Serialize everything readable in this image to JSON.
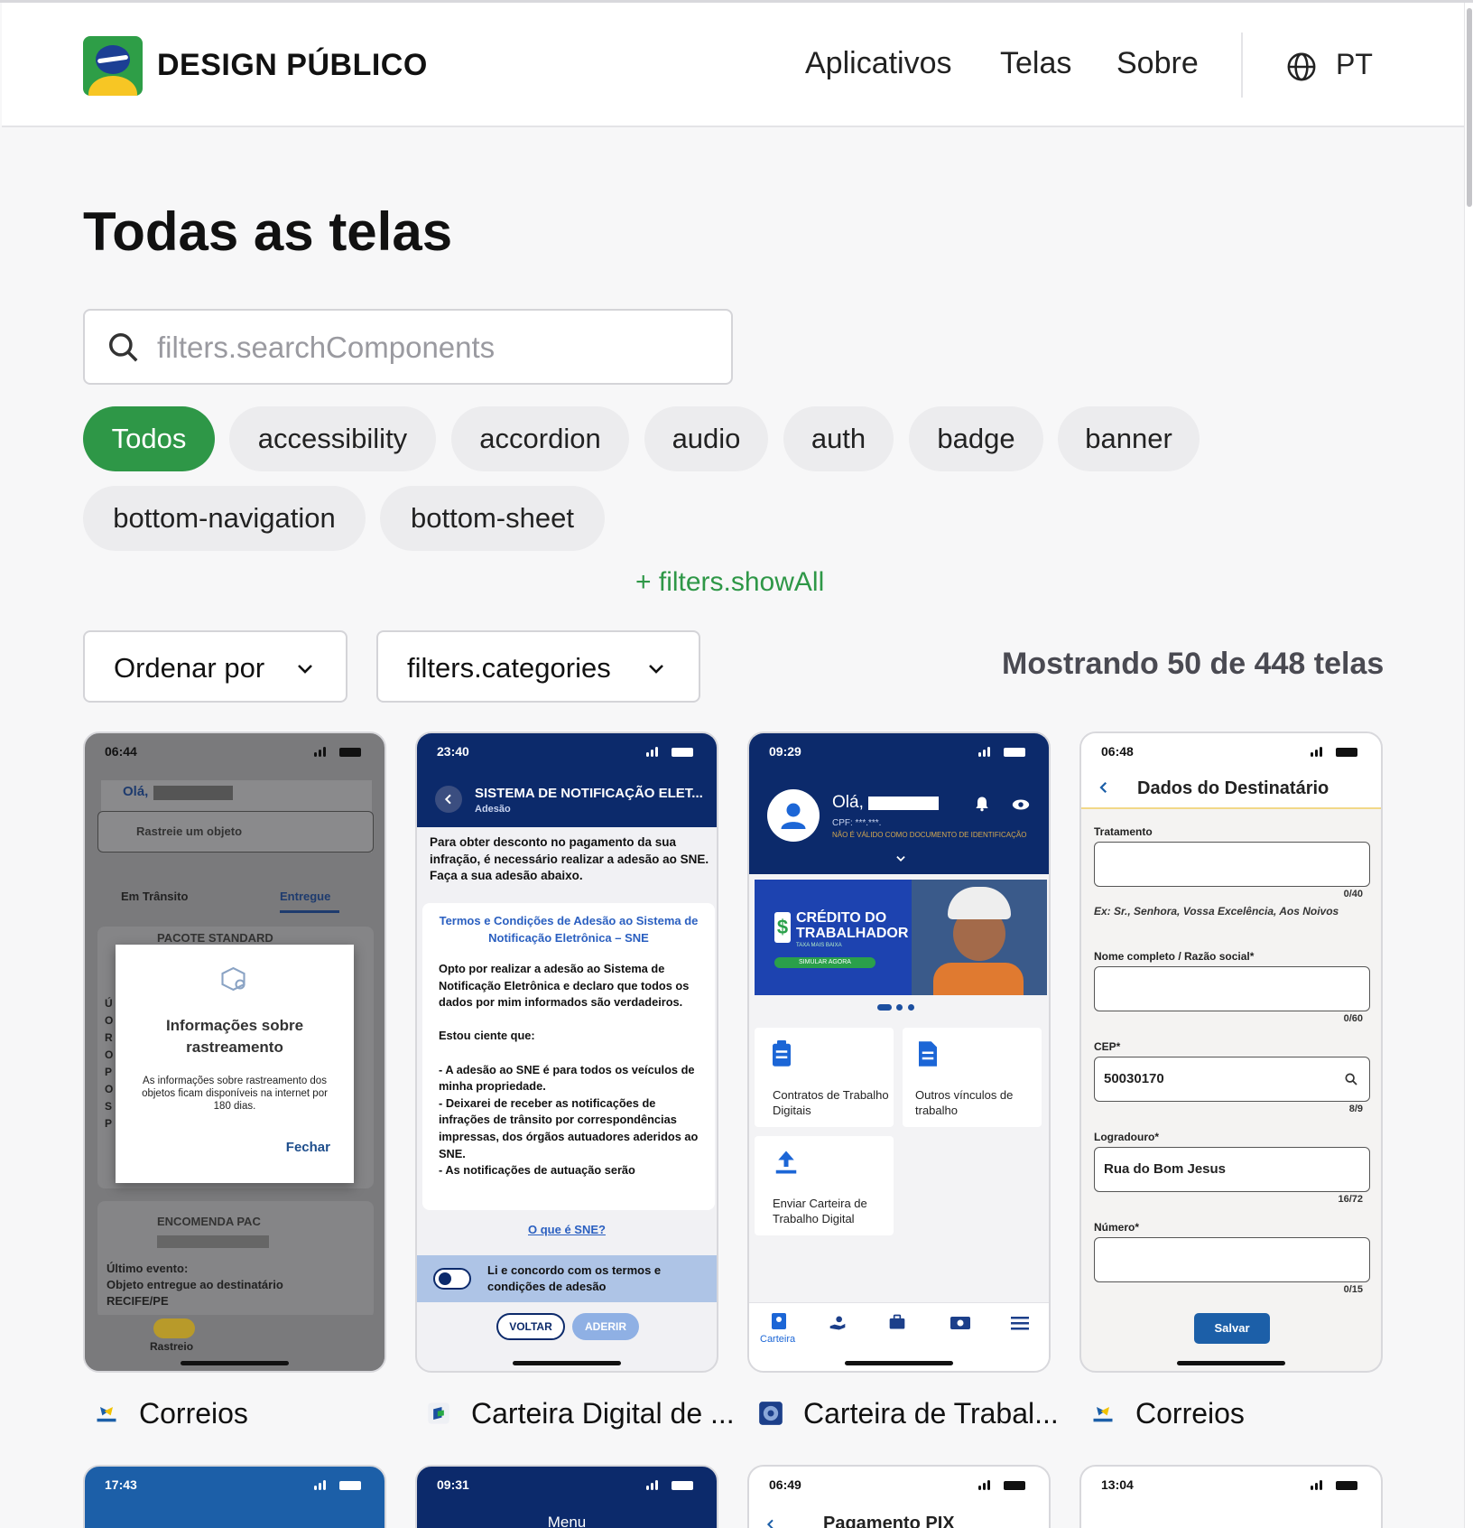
{
  "header": {
    "brand": "DESIGN PÚBLICO",
    "nav": [
      "Aplicativos",
      "Telas",
      "Sobre"
    ],
    "lang": "PT"
  },
  "page": {
    "title": "Todas as telas",
    "search_placeholder": "filters.searchComponents",
    "chips": [
      "Todos",
      "accessibility",
      "accordion",
      "audio",
      "auth",
      "badge",
      "banner",
      "bottom-navigation",
      "bottom-sheet"
    ],
    "show_all": "+ filters.showAll",
    "sort_label": "Ordenar por",
    "categories_label": "filters.categories",
    "count_text": "Mostrando 50 de 448 telas"
  },
  "colors": {
    "accent": "#2e9747",
    "navy": "#0c2a6b",
    "correios_blue": "#1c5fa8"
  },
  "cards": [
    {
      "app": "Correios",
      "time": "06:44",
      "greeting": "Olá,",
      "search": "Rastreie um objeto",
      "tab1": "Em Trânsito",
      "tab2": "Entregue",
      "under_title": "PACOTE STANDARD",
      "side_letters": [
        "Ú",
        "O",
        "R",
        "O",
        "P",
        "O",
        "S",
        "P"
      ],
      "modal_title": "Informações sobre rastreamento",
      "modal_text": "As informações sobre rastreamento dos objetos ficam disponíveis na internet por 180 dias.",
      "modal_btn": "Fechar",
      "item_title": "ENCOMENDA PAC",
      "last_event_label": "Último evento:",
      "last_event": "Objeto entregue ao destinatário",
      "city": "RECIFE/PE",
      "nav_label": "Rastreio"
    },
    {
      "app": "Carteira Digital de ...",
      "time": "23:40",
      "header_title": "SISTEMA DE NOTIFICAÇÃO ELET...",
      "header_sub": "Adesão",
      "intro": "Para obter desconto no pagamento da sua infração, é necessário realizar a adesão ao SNE.",
      "intro2": "Faça a sua adesão abaixo.",
      "terms_title": "Termos e Condições de Adesão ao Sistema de Notificação Eletrônica – SNE",
      "terms_p1": "Opto por realizar a adesão ao Sistema de Notificação Eletrônica e declaro que todos os dados por mim informados são verdadeiros.",
      "terms_p2": "Estou ciente que:",
      "terms_p3": "- A adesão ao SNE é para todos os veículos de minha propriedade.",
      "terms_p4": "- Deixarei de receber as notificações de infrações de trânsito por correspondências impressas, dos órgãos autuadores aderidos ao SNE.",
      "terms_p5": "- As notificações de autuação serão",
      "link": "O que é SNE?",
      "agree": "Li e concordo com os termos e condições de adesão",
      "btn_back": "VOLTAR",
      "btn_join": "ADERIR"
    },
    {
      "app": "Carteira de Trabal...",
      "time": "09:29",
      "greeting": "Olá,",
      "cpf": "CPF: ***.***.",
      "note": "NÃO É VÁLIDO COMO DOCUMENTO DE IDENTIFICAÇÃO",
      "banner_title": "CRÉDITO DO TRABALHADOR",
      "banner_sub": "TAXA MAIS BAIXA",
      "banner_btn": "SIMULAR AGORA",
      "tile1": "Contratos de Trabalho Digitais",
      "tile2": "Outros vínculos de trabalho",
      "tile3": "Enviar Carteira de Trabalho Digital",
      "nav_label": "Carteira"
    },
    {
      "app": "Correios",
      "time": "06:48",
      "title": "Dados do Destinatário",
      "f1_label": "Tratamento",
      "f1_count": "0/40",
      "f1_hint": "Ex: Sr., Senhora, Vossa Excelência, Aos Noivos",
      "f2_label": "Nome completo / Razão social*",
      "f2_count": "0/60",
      "f3_label": "CEP*",
      "f3_value": "50030170",
      "f3_count": "8/9",
      "f4_label": "Logradouro*",
      "f4_value": "Rua do Bom Jesus",
      "f4_count": "16/72",
      "f5_label": "Número*",
      "f5_count": "0/15",
      "save": "Salvar"
    }
  ],
  "row2": [
    {
      "time": "17:43"
    },
    {
      "time": "09:31",
      "title": "Menu"
    },
    {
      "time": "06:49",
      "title": "Pagamento PIX"
    },
    {
      "time": "13:04"
    }
  ]
}
